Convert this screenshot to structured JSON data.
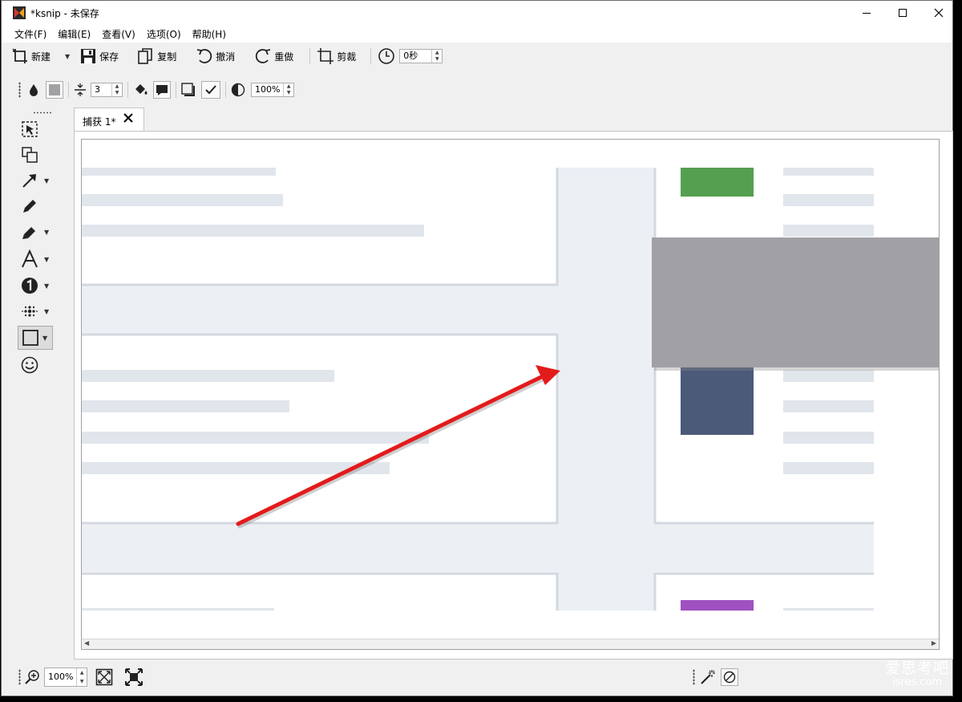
{
  "window": {
    "title": "*ksnip - 未保存"
  },
  "menu": [
    "文件(F)",
    "编辑(E)",
    "查看(V)",
    "选项(O)",
    "帮助(H)"
  ],
  "toolbar": {
    "new_label": "新建",
    "save_label": "保存",
    "copy_label": "复制",
    "undo_label": "撤消",
    "redo_label": "重做",
    "crop_label": "剪裁",
    "delay_value": "0秒"
  },
  "settings": {
    "width_value": "3",
    "opacity_value": "100%"
  },
  "tab": {
    "label": "捕获 1*"
  },
  "zoom": {
    "value": "100%"
  },
  "watermark": {
    "line1": "爱思考吧",
    "line2": "isres.com"
  },
  "colors": {
    "arrow": "#e31b1b",
    "green_block": "#55a050",
    "slate_block": "#4a5a78",
    "purple_block": "#a050c0",
    "redact_rect": "#a1a0a4"
  }
}
